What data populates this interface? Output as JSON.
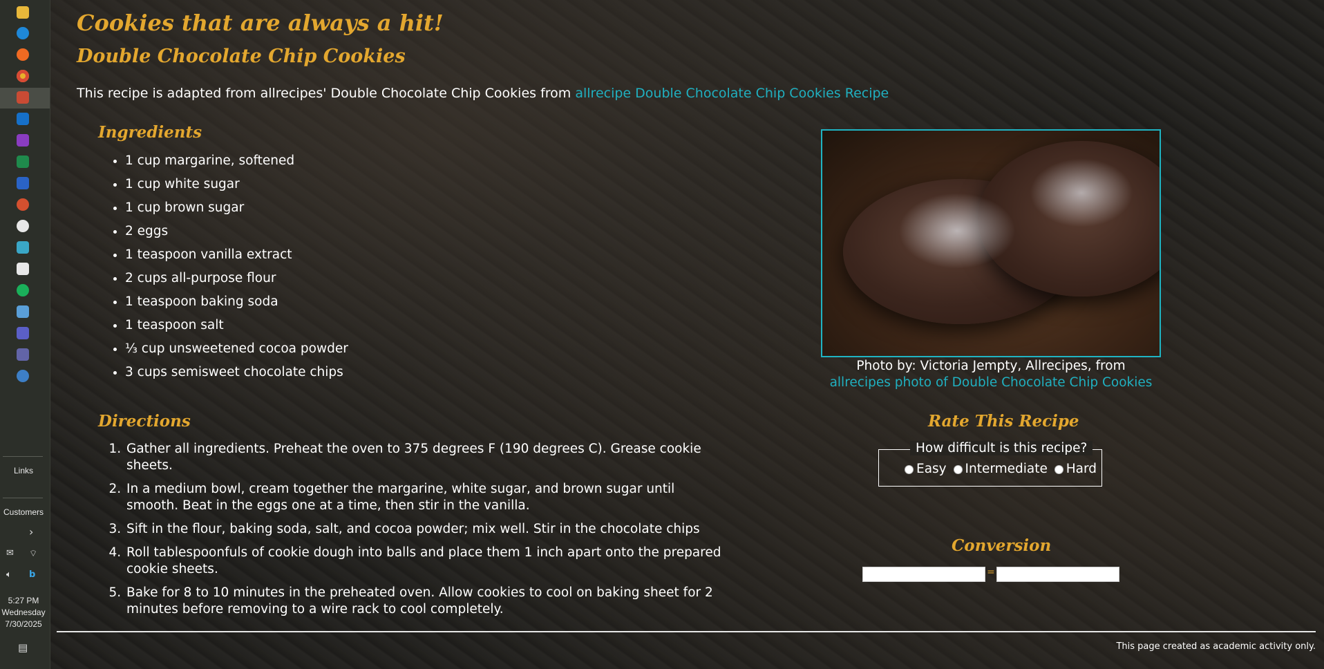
{
  "taskbar": {
    "icons": [
      "file-explorer-icon",
      "edge-icon",
      "firefox-icon",
      "chrome-icon",
      "app-icon",
      "outlook-icon",
      "onenote-icon",
      "excel-icon",
      "word-icon",
      "powerpoint-icon",
      "settings-icon",
      "solitaire-icon",
      "puzzle-icon",
      "green-circle-icon",
      "snipping-icon",
      "teams-icon",
      "teams-alt-icon",
      "gear-app-icon"
    ],
    "links_label": "Links",
    "customers_label": "Customers",
    "time": "5:27 PM",
    "day": "Wednesday",
    "date": "7/30/2025"
  },
  "page": {
    "title": "Cookies that are always a hit!",
    "subtitle": "Double Chocolate Chip Cookies",
    "intro_text": "This recipe is adapted from allrecipes' Double Chocolate Chip Cookies from ",
    "intro_link": "allrecipe Double Chocolate Chip Cookies Recipe",
    "ingredients_heading": "Ingredients",
    "ingredients": [
      "1 cup margarine, softened",
      "1 cup white sugar",
      "1 cup brown sugar",
      "2 eggs",
      "1 teaspoon vanilla extract",
      "2 cups all-purpose flour",
      "1 teaspoon baking soda",
      "1 teaspoon salt",
      "⅓ cup unsweetened cocoa powder",
      "3 cups semisweet chocolate chips"
    ],
    "directions_heading": "Directions",
    "directions": [
      "Gather all ingredients. Preheat the oven to 375 degrees F (190 degrees C). Grease cookie sheets.",
      "In a medium bowl, cream together the margarine, white sugar, and brown sugar until smooth. Beat in the eggs one at a time, then stir in the vanilla.",
      "Sift in the flour, baking soda, salt, and cocoa powder; mix well. Stir in the chocolate chips",
      "Roll tablespoonfuls of cookie dough into balls and place them 1 inch apart onto the prepared cookie sheets.",
      "Bake for 8 to 10 minutes in the preheated oven. Allow cookies to cool on baking sheet for 2 minutes before removing to a wire rack to cool completely."
    ],
    "photo_caption": "Photo by: Victoria Jempty, Allrecipes, from",
    "photo_link": "allrecipes photo of Double Chocolate Chip Cookies",
    "rate_heading": "Rate This Recipe",
    "rate_legend": "How difficult is this recipe?",
    "rate_options": [
      "Easy",
      "Intermediate",
      "Hard"
    ],
    "conversion_heading": "Conversion",
    "conversion_eq": "=",
    "footer": "This page created as academic activity only."
  },
  "colors": {
    "heading": "#e3a72f",
    "link": "#20b0c0",
    "photo_border": "#1fb4c3"
  }
}
